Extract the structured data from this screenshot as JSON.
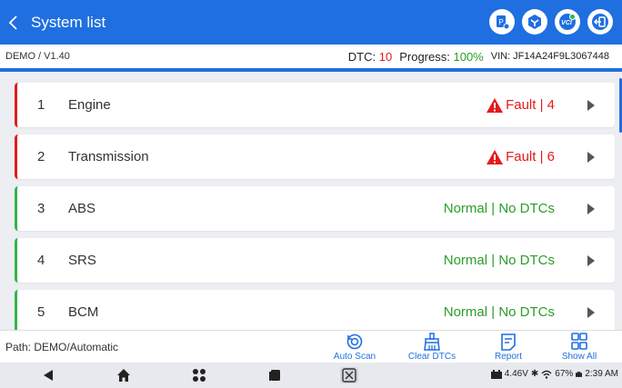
{
  "header": {
    "title": "System list",
    "icons": [
      "code-badge-icon",
      "settings-hex-icon",
      "vci-connected-icon",
      "exit-icon"
    ],
    "vci_label": "VCI"
  },
  "info": {
    "demo": "DEMO / V1.40",
    "dtc_label": "DTC:",
    "dtc_value": "10",
    "progress_label": "Progress:",
    "progress_value": "100%",
    "vin": "VIN: JF14A24F9L3067448"
  },
  "systems": [
    {
      "num": "1",
      "name": "Engine",
      "status": "Fault | 4",
      "kind": "fault"
    },
    {
      "num": "2",
      "name": "Transmission",
      "status": "Fault | 6",
      "kind": "fault"
    },
    {
      "num": "3",
      "name": "ABS",
      "status": "Normal | No DTCs",
      "kind": "normal"
    },
    {
      "num": "4",
      "name": "SRS",
      "status": "Normal | No DTCs",
      "kind": "normal"
    },
    {
      "num": "5",
      "name": "BCM",
      "status": "Normal | No DTCs",
      "kind": "normal"
    }
  ],
  "bottom": {
    "path": "Path: DEMO/Automatic",
    "actions": {
      "auto_scan": "Auto Scan",
      "clear_dtcs": "Clear DTCs",
      "report": "Report",
      "show_all": "Show All"
    }
  },
  "tray": {
    "voltage": "4.46V",
    "battery": "67%",
    "time": "2:39 AM"
  },
  "colors": {
    "accent": "#1f6fe0",
    "fault": "#e31b1b",
    "normal": "#2a9d2a"
  }
}
